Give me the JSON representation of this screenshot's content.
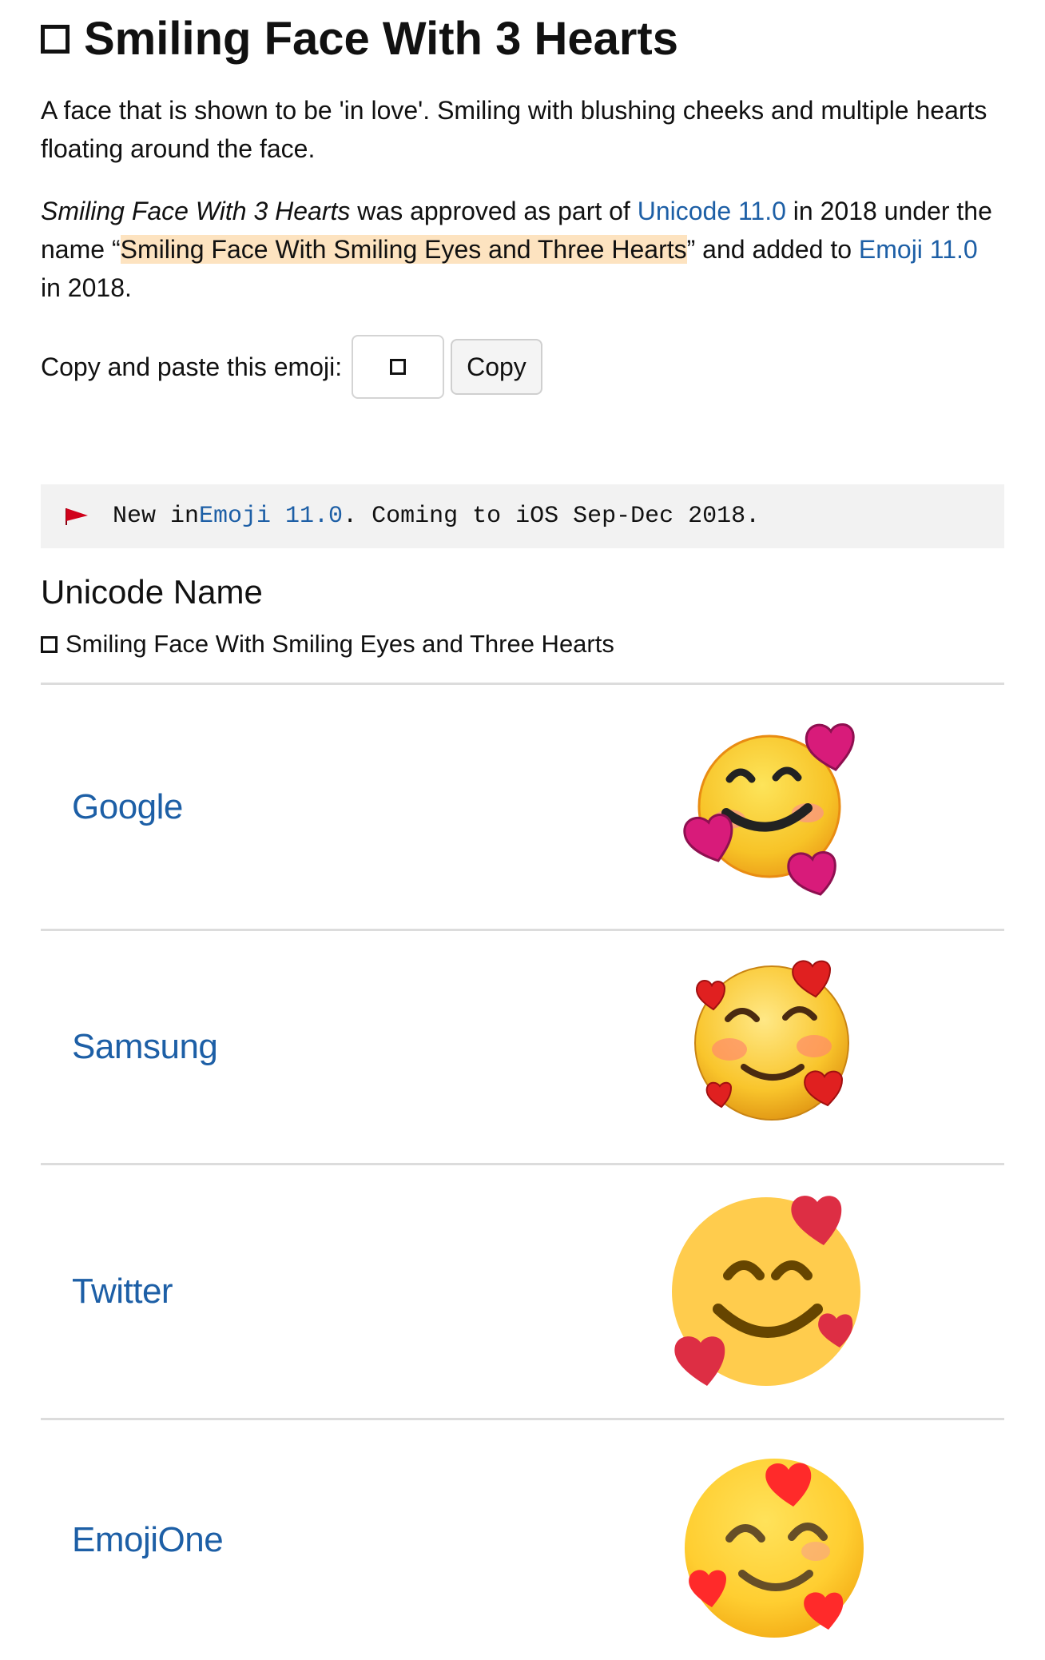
{
  "page": {
    "title": "Smiling Face With 3 Hearts",
    "description": "A face that is shown to be 'in love'. Smiling with blushing cheeks and multiple hearts floating around the face.",
    "approval": {
      "name_italic": "Smiling Face With 3 Hearts",
      "t1": " was approved as part of ",
      "unicode_link": "Unicode 11.0",
      "t2": " in 2018 under the name “",
      "official_name": "Smiling Face With Smiling Eyes and Three Hearts",
      "t3": "” and added to ",
      "emoji_link": "Emoji 11.0",
      "t4": " in 2018."
    },
    "copy": {
      "label": "Copy and paste this emoji:",
      "button": "Copy"
    },
    "notice": {
      "t1": "New in ",
      "link": "Emoji 11.0",
      "t2": ". Coming to iOS Sep-Dec 2018."
    },
    "unicode_name": {
      "heading": "Unicode Name",
      "value": "Smiling Face With Smiling Eyes and Three Hearts"
    },
    "vendors": [
      "Google",
      "Samsung",
      "Twitter",
      "EmojiOne"
    ]
  },
  "colors": {
    "link": "#1d5fa6",
    "highlight": "#fde3c0",
    "notice_bg": "#f2f2f2",
    "flag": "#d0021b"
  }
}
